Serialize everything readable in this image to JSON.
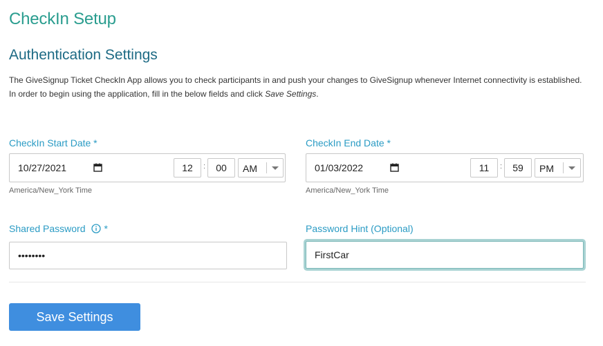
{
  "page": {
    "title": "CheckIn Setup"
  },
  "auth": {
    "title": "Authentication Settings",
    "desc_line1": "The GiveSignup Ticket CheckIn App allows you to check participants in and push your changes to GiveSignup whenever Internet connectivity is established.",
    "desc_line2_prefix": "In order to begin using the application, fill in the below fields and click ",
    "desc_line2_emph": "Save Settings",
    "desc_line2_suffix": "."
  },
  "start": {
    "label": "CheckIn Start Date *",
    "date": "10/27/2021",
    "hour": "12",
    "minute": "00",
    "ampm": "AM",
    "timezone": "America/New_York Time"
  },
  "end": {
    "label": "CheckIn End Date *",
    "date": "01/03/2022",
    "hour": "11",
    "minute": "59",
    "ampm": "PM",
    "timezone": "America/New_York Time"
  },
  "password": {
    "label": "Shared Password",
    "required_mark": "*",
    "value": "••••••••"
  },
  "hint": {
    "label": "Password Hint (Optional)",
    "value": "FirstCar"
  },
  "actions": {
    "save_label": "Save Settings"
  },
  "colors": {
    "teal": "#2a9d8f",
    "label_blue": "#2a9bc4",
    "button_blue": "#3f8edf"
  }
}
